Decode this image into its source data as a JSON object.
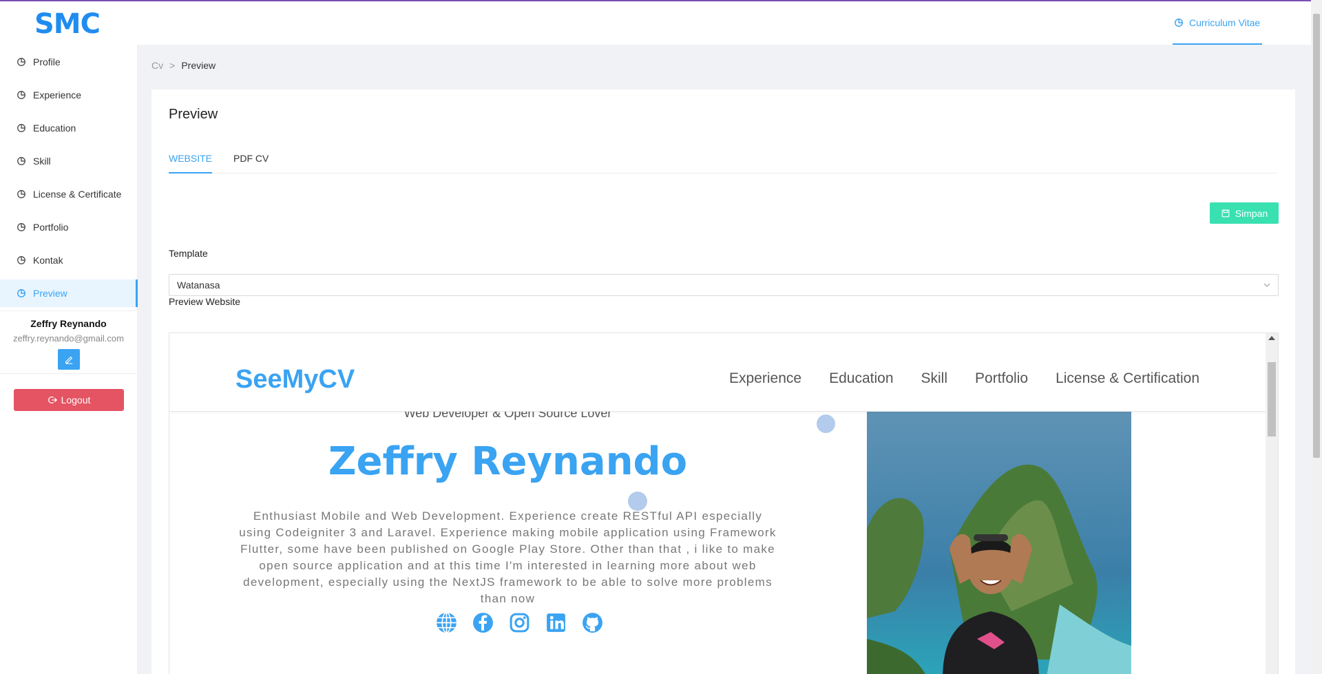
{
  "app": {
    "logo": "SMC",
    "top_tab": "Curriculum Vitae"
  },
  "sidebar": {
    "items": [
      {
        "label": "Profile",
        "icon": "pie-chart-icon"
      },
      {
        "label": "Experience",
        "icon": "pie-chart-icon"
      },
      {
        "label": "Education",
        "icon": "pie-chart-icon"
      },
      {
        "label": "Skill",
        "icon": "pie-chart-icon"
      },
      {
        "label": "License & Certificate",
        "icon": "pie-chart-icon"
      },
      {
        "label": "Portfolio",
        "icon": "pie-chart-icon"
      },
      {
        "label": "Kontak",
        "icon": "pie-chart-icon"
      },
      {
        "label": "Preview",
        "icon": "pie-chart-icon",
        "active": true
      }
    ],
    "user": {
      "name": "Zeffry Reynando",
      "email": "zeffry.reynando@gmail.com"
    },
    "logout_label": "Logout"
  },
  "breadcrumb": {
    "root": "Cv",
    "separator": ">",
    "current": "Preview"
  },
  "card": {
    "title": "Preview",
    "tabs": [
      {
        "label": "WEBSITE",
        "active": true
      },
      {
        "label": "PDF CV",
        "active": false
      }
    ],
    "save_label": "Simpan",
    "template_label": "Template",
    "template_value": "Watanasa",
    "preview_label": "Preview Website"
  },
  "preview": {
    "logo": "SeeMyCV",
    "nav": [
      "Experience",
      "Education",
      "Skill",
      "Portfolio",
      "License & Certification"
    ],
    "tagline": "Web Developer & Open Source Lover",
    "name": "Zeffry Reynando",
    "description": "Enthusiast Mobile and Web Development. Experience create RESTful API especially using Codeigniter 3 and Laravel. Experience making mobile application using Framework Flutter, some have been published on Google Play Store. Other than that , i like to make open source application and at this time I'm interested in learning more about web development, especially using the NextJS framework to be able to solve more problems than now",
    "socials": [
      "globe-icon",
      "facebook-icon",
      "instagram-icon",
      "linkedin-icon",
      "github-icon"
    ]
  },
  "colors": {
    "accent": "#3aa3f2",
    "logo": "#1f8cf0",
    "save": "#39e0b0",
    "logout": "#e45462",
    "top_border": "#7b4fb5"
  }
}
